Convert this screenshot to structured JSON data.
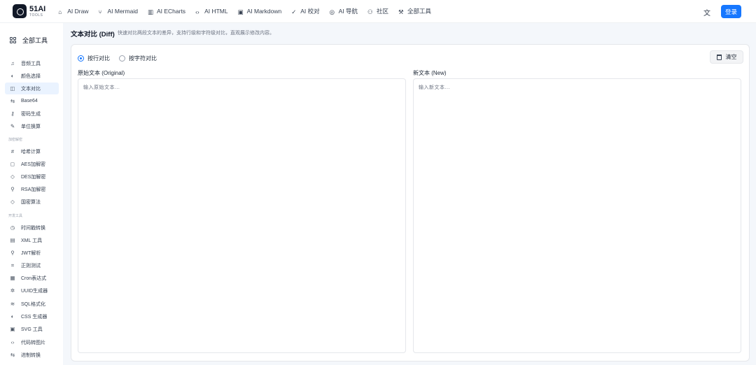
{
  "brand": {
    "name": "51AI",
    "sub": "TOOLS"
  },
  "nav": [
    {
      "label": "AI Draw",
      "icon": "brush-icon",
      "glyph": "⌂"
    },
    {
      "label": "AI Mermaid",
      "icon": "branch-icon",
      "glyph": "⑂"
    },
    {
      "label": "AI ECharts",
      "icon": "bar-chart-icon",
      "glyph": "▥"
    },
    {
      "label": "AI HTML",
      "icon": "code-icon",
      "glyph": "‹›"
    },
    {
      "label": "AI Markdown",
      "icon": "image-icon",
      "glyph": "▣"
    },
    {
      "label": "AI 校对",
      "icon": "check-circle-icon",
      "glyph": "✓"
    },
    {
      "label": "AI 导航",
      "icon": "compass-icon",
      "glyph": "◎"
    },
    {
      "label": "社区",
      "icon": "users-icon",
      "glyph": "⚇"
    },
    {
      "label": "全部工具",
      "icon": "wrench-icon",
      "glyph": "⚒"
    }
  ],
  "login_label": "登录",
  "sidebar": {
    "all_tools": "全部工具",
    "groups": [
      "加密解密",
      "开发工具"
    ],
    "items": [
      {
        "label": "音频工具",
        "glyph": "♫",
        "icon": "music-icon"
      },
      {
        "label": "颜色选择",
        "glyph": "◐",
        "icon": "palette-icon"
      },
      {
        "label": "文本对比",
        "glyph": "◫",
        "icon": "columns-icon",
        "active": true
      },
      {
        "label": "Base64",
        "glyph": "⇆",
        "icon": "swap-icon"
      },
      {
        "label": "密码生成",
        "glyph": "⚷",
        "icon": "key-icon"
      },
      {
        "label": "单位换算",
        "glyph": "✎",
        "icon": "ruler-icon"
      },
      {
        "label": "哈希计算",
        "glyph": "#",
        "icon": "hash-icon"
      },
      {
        "label": "AES加解密",
        "glyph": "◻",
        "icon": "lock-icon"
      },
      {
        "label": "DES加解密",
        "glyph": "◇",
        "icon": "shield-icon"
      },
      {
        "label": "RSA加解密",
        "glyph": "⚲",
        "icon": "key-icon"
      },
      {
        "label": "国密算法",
        "glyph": "◇",
        "icon": "shield-icon"
      },
      {
        "label": "时间戳转换",
        "glyph": "◷",
        "icon": "clock-icon"
      },
      {
        "label": "XML 工具",
        "glyph": "▤",
        "icon": "file-icon"
      },
      {
        "label": "JWT解析",
        "glyph": "⚲",
        "icon": "key-icon"
      },
      {
        "label": "正则测试",
        "glyph": "⌗",
        "icon": "scan-icon"
      },
      {
        "label": "Cron表达式",
        "glyph": "▦",
        "icon": "calendar-icon"
      },
      {
        "label": "UUID生成器",
        "glyph": "✲",
        "icon": "fingerprint-icon"
      },
      {
        "label": "SQL格式化",
        "glyph": "≋",
        "icon": "database-icon"
      },
      {
        "label": "CSS 生成器",
        "glyph": "◐",
        "icon": "palette-icon"
      },
      {
        "label": "SVG 工具",
        "glyph": "▣",
        "icon": "image-icon"
      },
      {
        "label": "代码转图片",
        "glyph": "‹›",
        "icon": "code-icon"
      },
      {
        "label": "进制转换",
        "glyph": "⇆",
        "icon": "swap-icon"
      }
    ]
  },
  "page": {
    "title": "文本对比 (Diff)",
    "description": "快速对比两段文本的差异，支持行级和字符级对比，直观展示修改内容。"
  },
  "modes": [
    {
      "label": "按行对比",
      "checked": true
    },
    {
      "label": "按字符对比",
      "checked": false
    }
  ],
  "clear_label": "清空",
  "original": {
    "label": "原始文本 (Original)",
    "placeholder": "输入原始文本..."
  },
  "modified": {
    "label": "新文本 (New)",
    "placeholder": "输入新文本..."
  },
  "colors": {
    "accent": "#1677ff",
    "active_bg": "#eaf3ff",
    "page_bg": "#f4f7fb"
  }
}
